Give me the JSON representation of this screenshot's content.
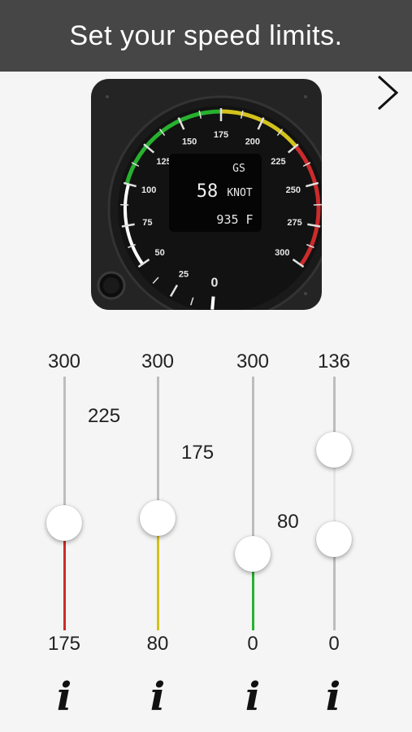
{
  "header": {
    "title": "Set your speed limits."
  },
  "gauge": {
    "ticks": [
      "0",
      "25",
      "50",
      "75",
      "100",
      "125",
      "150",
      "175",
      "200",
      "225",
      "250",
      "275",
      "300"
    ],
    "display": {
      "mode": "GS",
      "speed": "58",
      "unit": "KNOT",
      "temp": "935 F"
    }
  },
  "sliders": [
    {
      "max": "300",
      "min": "175",
      "value": "225",
      "fill_color": "#cc2b2b"
    },
    {
      "max": "300",
      "min": "80",
      "value": "175",
      "fill_color": "#d4c21c"
    },
    {
      "max": "300",
      "min": "0",
      "value": "80",
      "fill_color": "#27b12f"
    },
    {
      "max": "136",
      "min": "0",
      "value": null,
      "fill_color": "#bdbdbd"
    }
  ],
  "icons": {
    "next": "chevron-right-icon",
    "info": "info-icon"
  }
}
